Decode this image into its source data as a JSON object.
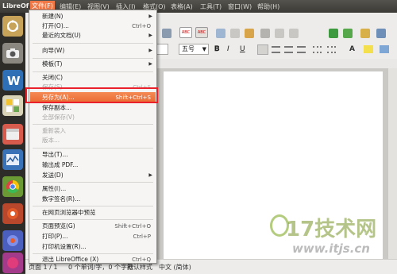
{
  "topbar": {
    "app_name": "LibreOf",
    "menus": [
      "文件(F)",
      "编辑(E)",
      "视图(V)",
      "插入(I)",
      "格式(O)",
      "表格(A)",
      "工具(T)",
      "窗口(W)",
      "帮助(H)"
    ],
    "active_menu": "文件(F)"
  },
  "window": {
    "title_fragment": "r"
  },
  "toolbar": {
    "font_size": "五号"
  },
  "file_menu": {
    "items": [
      {
        "label": "新建(N)",
        "shortcut": "",
        "submenu": true,
        "disabled": false
      },
      {
        "label": "打开(O)...",
        "shortcut": "Ctrl+O",
        "submenu": false,
        "disabled": false
      },
      {
        "label": "最近的文档(U)",
        "shortcut": "",
        "submenu": true,
        "disabled": false
      },
      {
        "label": "向导(W)",
        "shortcut": "",
        "submenu": true,
        "disabled": false
      },
      {
        "label": "模板(T)",
        "shortcut": "",
        "submenu": true,
        "disabled": false
      },
      {
        "label": "关闭(C)",
        "shortcut": "",
        "submenu": false,
        "disabled": false
      },
      {
        "label": "保存(S)",
        "shortcut": "Ctrl+S",
        "submenu": false,
        "disabled": true
      },
      {
        "label": "另存为(A)...",
        "shortcut": "Shift+Ctrl+S",
        "submenu": false,
        "disabled": false,
        "highlighted": true
      },
      {
        "label": "保存副本...",
        "shortcut": "",
        "submenu": false,
        "disabled": false
      },
      {
        "label": "全部保存(V)",
        "shortcut": "",
        "submenu": false,
        "disabled": true
      },
      {
        "label": "重新装入",
        "shortcut": "",
        "submenu": false,
        "disabled": true
      },
      {
        "label": "版本...",
        "shortcut": "",
        "submenu": false,
        "disabled": true
      },
      {
        "label": "导出(T)...",
        "shortcut": "",
        "submenu": false,
        "disabled": false
      },
      {
        "label": "输出成 PDF...",
        "shortcut": "",
        "submenu": false,
        "disabled": false
      },
      {
        "label": "发送(D)",
        "shortcut": "",
        "submenu": true,
        "disabled": false
      },
      {
        "label": "属性(I)...",
        "shortcut": "",
        "submenu": false,
        "disabled": false
      },
      {
        "label": "数字签名(R)...",
        "shortcut": "",
        "submenu": false,
        "disabled": false
      },
      {
        "label": "在网页浏览器中预览",
        "shortcut": "",
        "submenu": false,
        "disabled": false
      },
      {
        "label": "页面预览(G)",
        "shortcut": "Shift+Ctrl+O",
        "submenu": false,
        "disabled": false
      },
      {
        "label": "打印(P)...",
        "shortcut": "Ctrl+P",
        "submenu": false,
        "disabled": false
      },
      {
        "label": "打印机设置(R)...",
        "shortcut": "",
        "submenu": false,
        "disabled": false
      },
      {
        "label": "退出 LibreOffice (X)",
        "shortcut": "Ctrl+Q",
        "submenu": false,
        "disabled": false
      }
    ]
  },
  "statusbar": {
    "page": "页面 1 / 1",
    "words": "0 个单词/字，0 个字符",
    "style": "默认样式",
    "language": "中文 (简体)"
  },
  "watermark": {
    "brand": "17技术网",
    "url": "www.itjs.cn"
  },
  "colors": {
    "accent": "#f07746",
    "highlight_box": "#e8212a"
  }
}
